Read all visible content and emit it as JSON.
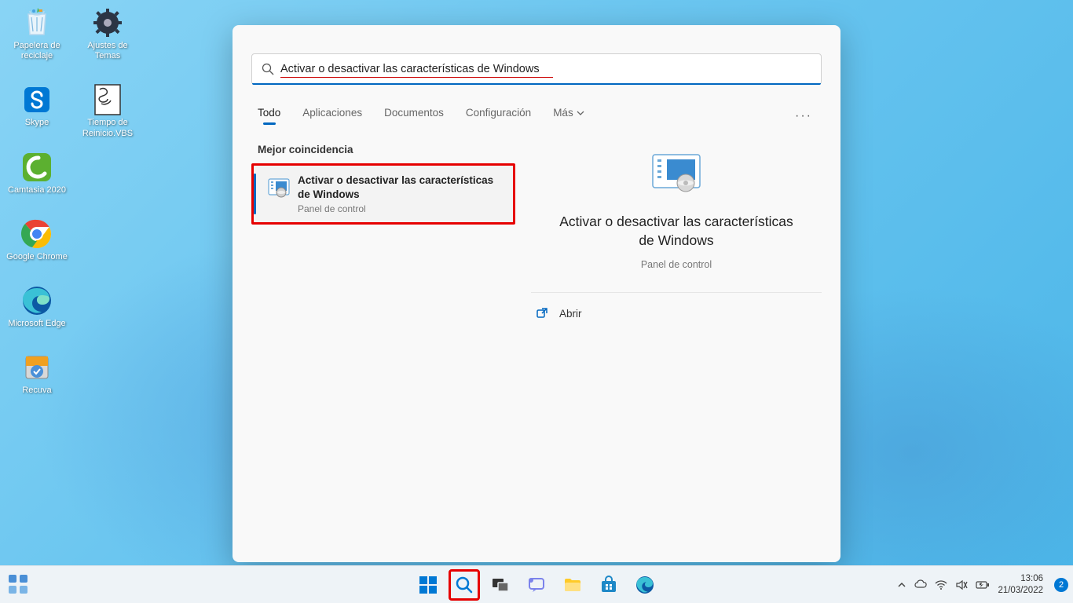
{
  "desktop": {
    "icons_col1": [
      {
        "name": "recycle-bin",
        "label": "Papelera de reciclaje"
      },
      {
        "name": "skype",
        "label": "Skype"
      },
      {
        "name": "camtasia",
        "label": "Camtasia 2020"
      },
      {
        "name": "chrome",
        "label": "Google Chrome"
      },
      {
        "name": "edge",
        "label": "Microsoft Edge"
      },
      {
        "name": "recuva",
        "label": "Recuva"
      }
    ],
    "icons_col2": [
      {
        "name": "theme-settings",
        "label": "Ajustes de Temas"
      },
      {
        "name": "reboot-script",
        "label": "Tiempo de Reinicio.VBS"
      }
    ]
  },
  "search": {
    "query": "Activar o desactivar las características de Windows",
    "tabs": [
      "Todo",
      "Aplicaciones",
      "Documentos",
      "Configuración"
    ],
    "more_label": "Más",
    "section_label": "Mejor coincidencia",
    "result": {
      "title": "Activar o desactivar las características de Windows",
      "sub": "Panel de control"
    },
    "preview": {
      "title": "Activar o desactivar las características de Windows",
      "sub": "Panel de control",
      "action": "Abrir"
    }
  },
  "taskbar": {
    "time": "13:06",
    "date": "21/03/2022",
    "notif_count": "2"
  }
}
